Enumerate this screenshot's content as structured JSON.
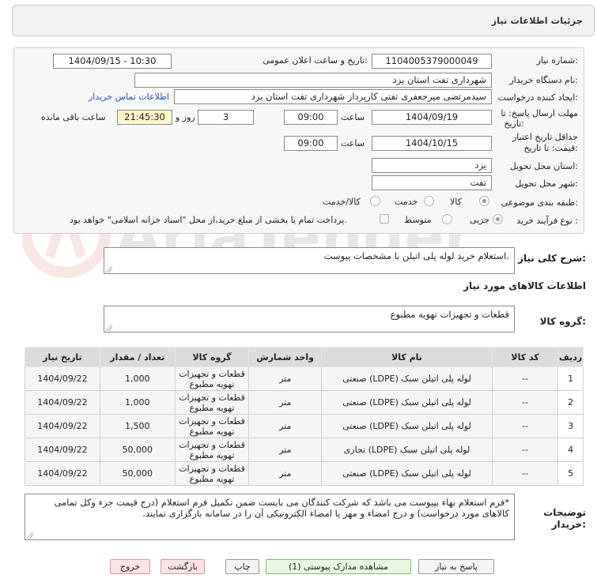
{
  "header": {
    "title": "جزئیات اطلاعات نیاز"
  },
  "form": {
    "need_number_label": "شماره نیاز:",
    "need_number": "1104005379000049",
    "announce_label": "تاریخ و ساعت اعلان عمومی:",
    "announce_value": "1404/09/15 - 10:30",
    "buyer_org_label": "نام دستگاه خریدار:",
    "buyer_org": "شهرداری تفت استان یزد",
    "creator_label": "ایجاد کننده درخواست:",
    "creator": "سیدمرتضی میرجعفری تفتی کارپرداز شهرداری تفت استان یزد",
    "contact_link": "اطلاعات تماس خریدار",
    "deadline_label_1": "مهلت ارسال پاسخ: تا",
    "deadline_label_2": "تاریخ:",
    "deadline_date": "1404/09/19",
    "time_word": "ساعت",
    "deadline_time": "09:00",
    "days_count": "3",
    "days_label": "روز و",
    "remaining_time": "21:45:30",
    "remaining_label": "ساعت باقی مانده",
    "validity_label_1": "حداقل تاریخ اعتبار",
    "validity_label_2": "قیمت: تا تاریخ:",
    "validity_date": "1404/10/15",
    "validity_time": "09:00",
    "province_label": "استان محل تحویل:",
    "province": "یزد",
    "city_label": "شهر محل تحویل:",
    "city": "تفت",
    "category_label": "طبقه بندی موضوعی:",
    "category_options": [
      "کالا",
      "خدمت",
      "کالا/خدمت"
    ],
    "category_selected": "کالا",
    "process_label": "نوع فرآیند خرید :",
    "process_options": [
      "جزیی",
      "متوسط"
    ],
    "process_selected": "جزیی",
    "payment_note": "پرداخت تمام یا بخشی از مبلغ خرید،از محل \"اسناد خزانه اسلامی\" خواهد بود."
  },
  "summary": {
    "label": "شرح کلی نیاز:",
    "value": "استعلام خرید لوله پلی اتیلن با مشخصات پیوست."
  },
  "goods": {
    "section_title": "اطلاعات کالاهای مورد نیاز",
    "group_label": "گروه کالا:",
    "group_value": "قطعات و تجهیزات تهویه مطبوع"
  },
  "table": {
    "headers": [
      "ردیف",
      "کد کالا",
      "نام کالا",
      "واحد شمارش",
      "گروه کالا",
      "تعداد / مقدار",
      "تاریخ نیاز"
    ],
    "rows": [
      [
        "1",
        "--",
        "لوله پلی اتیلن سبک (LDPE) صنعتی",
        "متر",
        "قطعات و تجهیزات تهویه مطبوع",
        "1,000",
        "1404/09/22"
      ],
      [
        "2",
        "--",
        "لوله پلی اتیلن سبک (LDPE) صنعتی",
        "متر",
        "قطعات و تجهیزات تهویه مطبوع",
        "1,000",
        "1404/09/22"
      ],
      [
        "3",
        "--",
        "لوله پلی اتیلن سبک (LDPE) صنعتی",
        "متر",
        "قطعات و تجهیزات تهویه مطبوع",
        "1,500",
        "1404/09/22"
      ],
      [
        "4",
        "--",
        "لوله پلی اتیلن سبک (LDPE) تجاری",
        "متر",
        "قطعات و تجهیزات تهویه مطبوع",
        "50,000",
        "1404/09/22"
      ],
      [
        "5",
        "--",
        "لوله پلی اتیلن سبک (LDPE) صنعتی",
        "متر",
        "قطعات و تجهیزات تهویه مطبوع",
        "50,000",
        "1404/09/22"
      ]
    ]
  },
  "notes": {
    "label_1": "توضیحات",
    "label_2": "خریدار:",
    "value": "*فرم استعلام بهاء بپیوست می باشد که شرکت کنندگان می بایست ضمن تکمیل فرم استعلام (درج قیمت جزء وکل تمامی کالاهای مورد درخواست) و درج امضاء و مهر یا امضاء الکترونیکی آن را در سامانه بارگزاری نمایند."
  },
  "buttons": {
    "reply": "پاسخ به نیاز",
    "view_docs": "مشاهده مدارک پیوستی (1)",
    "print": "چاپ",
    "back": "بازگشت",
    "exit": "خروج"
  },
  "watermark": {
    "text": "AriaTender.net"
  },
  "colors": {
    "link": "#1f55c2",
    "remaining_bg": "#fff6c8",
    "header_row": "#dcdcdc"
  }
}
